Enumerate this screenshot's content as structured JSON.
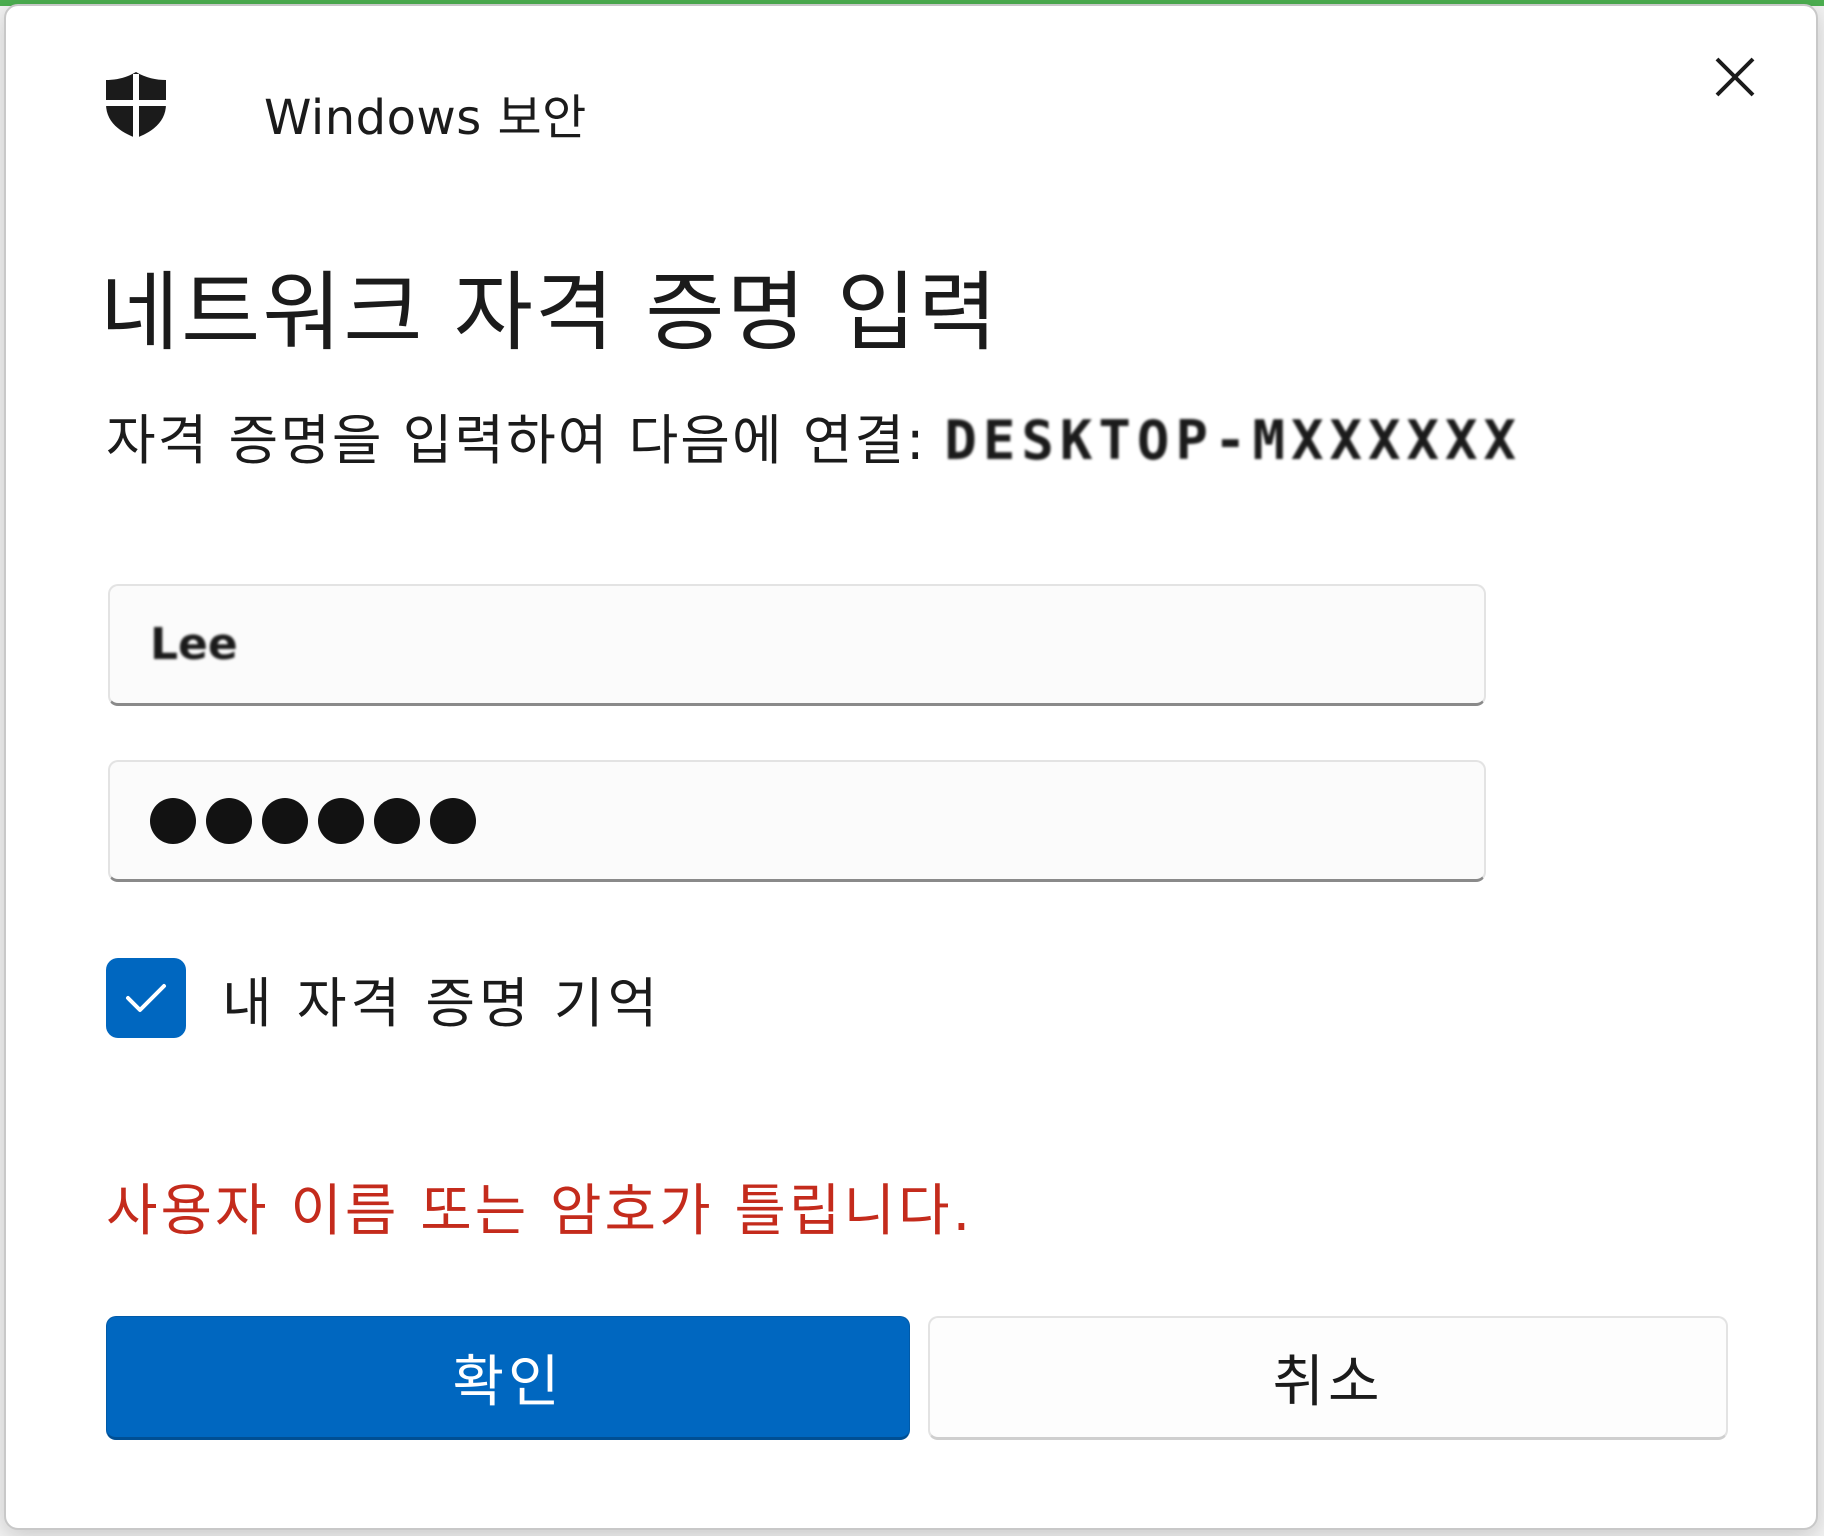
{
  "window": {
    "app_title": "Windows 보안",
    "close_icon": "close-icon",
    "app_icon": "shield-icon"
  },
  "dialog": {
    "heading": "네트워크 자격 증명 입력",
    "subtitle_prefix": "자격 증명을 입력하여 다음에 연결:",
    "subtitle_target": "DESKTOP-MXXXXXX"
  },
  "form": {
    "username_value": "Lee",
    "password_mask_count": 6,
    "remember_checked": true,
    "remember_label": "내 자격 증명 기억"
  },
  "error": {
    "message": "사용자 이름 또는 암호가 틀립니다.",
    "color": "#c42b1c"
  },
  "buttons": {
    "ok_label": "확인",
    "cancel_label": "취소"
  },
  "colors": {
    "accent": "#0067c0"
  }
}
